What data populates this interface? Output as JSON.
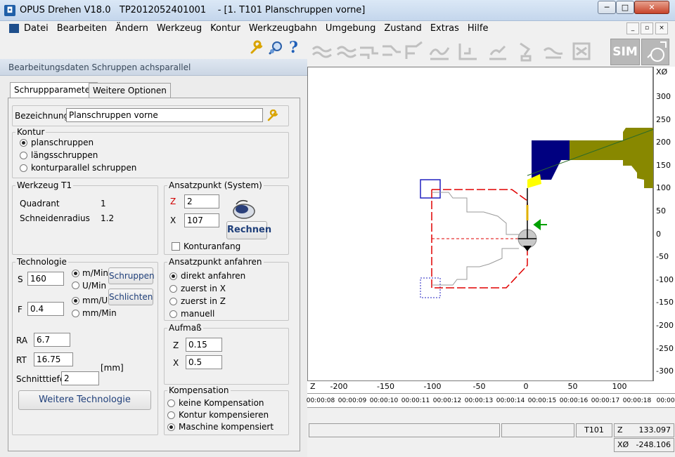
{
  "window": {
    "title": "OPUS Drehen V18.0   TP2012052401001    - [1. T101 Planschruppen vorne]",
    "min_glyph": "─",
    "max_glyph": "□",
    "close_glyph": "✕"
  },
  "menu": {
    "items": [
      "Datei",
      "Bearbeiten",
      "Ändern",
      "Werkzeug",
      "Kontur",
      "Werkzeugbahn",
      "Umgebung",
      "Zustand",
      "Extras",
      "Hilfe"
    ],
    "mdi_min": "_",
    "mdi_restore": "▫",
    "mdi_close": "×"
  },
  "left_toolbar": {
    "icons": [
      "wrench-icon",
      "tool-search-icon",
      "help-icon"
    ],
    "help_glyph": "?"
  },
  "section": {
    "title": "Bearbeitungsdaten Schruppen achsparallel"
  },
  "tabs": [
    {
      "label": "Schruppparameter",
      "active": true
    },
    {
      "label": "Weitere Optionen",
      "active": false
    }
  ],
  "bezeichnung": {
    "label": "Bezeichnung",
    "value": "Planschruppen vorne"
  },
  "kontur": {
    "title": "Kontur",
    "options": [
      {
        "label": "planschruppen",
        "selected": true
      },
      {
        "label": "längsschruppen",
        "selected": false
      },
      {
        "label": "konturparallel schruppen",
        "selected": false
      }
    ]
  },
  "werkzeug": {
    "title": "Werkzeug T1",
    "quadrant_label": "Quadrant",
    "quadrant_value": "1",
    "radius_label": "Schneidenradius",
    "radius_value": "1.2"
  },
  "ansatzpunkt": {
    "title": "Ansatzpunkt (System)",
    "z_label": "Z",
    "z_value": "2",
    "x_label": "X",
    "x_value": "107",
    "rechnen_label": "Rechnen",
    "konturanfang_label": "Konturanfang",
    "konturanfang_checked": false
  },
  "technologie": {
    "title": "Technologie",
    "s_label": "S",
    "s_value": "160",
    "f_label": "F",
    "f_value": "0.4",
    "s_units": [
      {
        "label": "m/Min",
        "selected": true
      },
      {
        "label": "U/Min",
        "selected": false
      }
    ],
    "f_units": [
      {
        "label": "mm/U",
        "selected": true
      },
      {
        "label": "mm/Min",
        "selected": false
      }
    ],
    "schruppen_label": "Schruppen",
    "schlichten_label": "Schlichten",
    "ra_label": "RA",
    "ra_value": "6.7",
    "rt_label": "RT",
    "rt_value": "16.75",
    "mm_label": "[mm]",
    "schnitttiefe_label": "Schnitttiefe",
    "schnitttiefe_value": "2",
    "weitere_label": "Weitere Technologie"
  },
  "anfahren": {
    "title": "Ansatzpunkt anfahren",
    "options": [
      {
        "label": "direkt anfahren",
        "selected": true
      },
      {
        "label": "zuerst in X",
        "selected": false
      },
      {
        "label": "zuerst in Z",
        "selected": false
      },
      {
        "label": "manuell",
        "selected": false
      }
    ]
  },
  "aufmass": {
    "title": "Aufmaß",
    "z_label": "Z",
    "z_value": "0.15",
    "x_label": "X",
    "x_value": "0.5"
  },
  "kompensation": {
    "title": "Kompensation",
    "options": [
      {
        "label": "keine Kompensation",
        "selected": false
      },
      {
        "label": "Kontur kompensieren",
        "selected": false
      },
      {
        "label": "Maschine kompensiert",
        "selected": true
      }
    ]
  },
  "right_toolbar": {
    "icons": [
      "path-1-icon",
      "path-2-icon",
      "path-3-icon",
      "path-4-icon",
      "path-5-icon",
      "path-6-icon",
      "path-7-icon",
      "path-8-icon",
      "path-9-icon",
      "path-10-icon",
      "path-11-icon"
    ],
    "sim_label": "SIM"
  },
  "drawing": {
    "y_axis_label": "XØ",
    "y_ticks": [
      "300",
      "250",
      "200",
      "150",
      "100",
      "50",
      "0",
      "-50",
      "-100",
      "-150",
      "-200",
      "-250",
      "-300"
    ],
    "x_axis_label": "Z",
    "x_ticks": [
      "-200",
      "-150",
      "-100",
      "-50",
      "0",
      "50",
      "100"
    ],
    "time_ticks": [
      "00:00:08",
      "00:00:09",
      "00:00:10",
      "00:00:11",
      "00:00:12",
      "00:00:13",
      "00:00:14",
      "00:00:15",
      "00:00:16",
      "00:00:17",
      "00:00:18",
      "00:00:1"
    ],
    "colors": {
      "workpiece": "#888800",
      "chuck": "#000080",
      "insert": "#ffff00",
      "path_red": "#e00000",
      "path_blue": "#2020c0",
      "contour": "#9a9a9a"
    }
  },
  "status": {
    "tool": "T101",
    "z_label": "Z",
    "z_value": "133.097",
    "x_label": "XØ",
    "x_value": "-248.106"
  }
}
